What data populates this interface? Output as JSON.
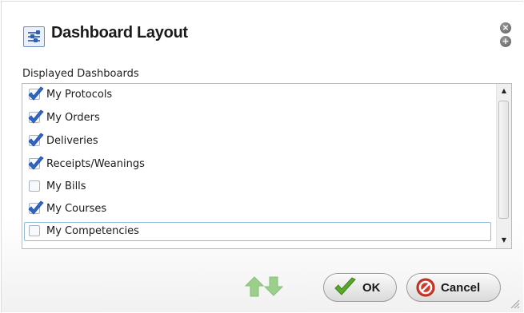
{
  "dialog": {
    "title": "Dashboard Layout",
    "title_icon": "layout-settings-icon",
    "close_icon": "close-icon",
    "add_icon": "add-icon"
  },
  "list": {
    "label": "Displayed Dashboards",
    "items": [
      {
        "label": "My Protocols",
        "checked": true
      },
      {
        "label": "My Orders",
        "checked": true
      },
      {
        "label": "Deliveries",
        "checked": true
      },
      {
        "label": "Receipts/Weanings",
        "checked": true
      },
      {
        "label": "My Bills",
        "checked": false
      },
      {
        "label": "My Courses",
        "checked": true
      },
      {
        "label": "My Competencies",
        "checked": false
      }
    ],
    "focused_item": "My Competencies"
  },
  "footer": {
    "move_up_icon": "move-up-arrow-icon",
    "move_down_icon": "move-down-arrow-icon",
    "ok_label": "OK",
    "cancel_label": "Cancel"
  },
  "colors": {
    "check_blue": "#2f66c8",
    "arrow_green": "#9ccf8c",
    "ok_green": "#5aa82a",
    "cancel_red": "#d23a2a"
  }
}
